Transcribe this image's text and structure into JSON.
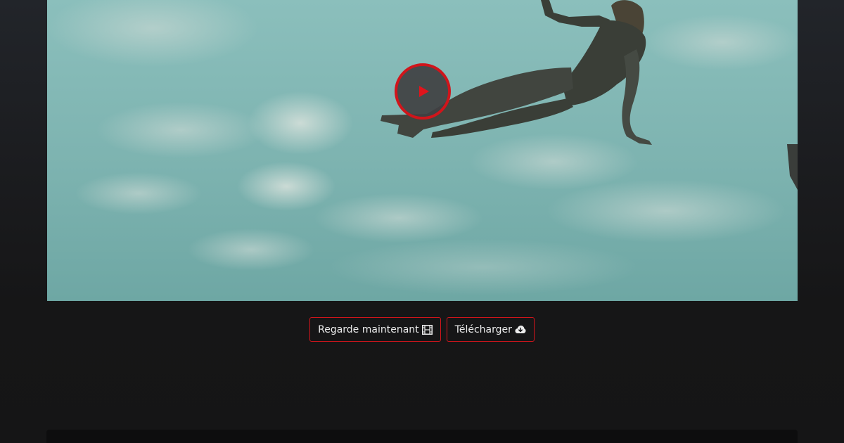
{
  "video": {
    "play_icon": "play-icon",
    "thumbnail": "diver-in-sky"
  },
  "actions": {
    "watch_label": "Regarde maintenant",
    "watch_icon": "film-icon",
    "download_label": "Télécharger",
    "download_icon": "cloud-download-icon"
  },
  "colors": {
    "accent": "#d0151b",
    "background": "#151516",
    "button_text": "#ececec"
  }
}
